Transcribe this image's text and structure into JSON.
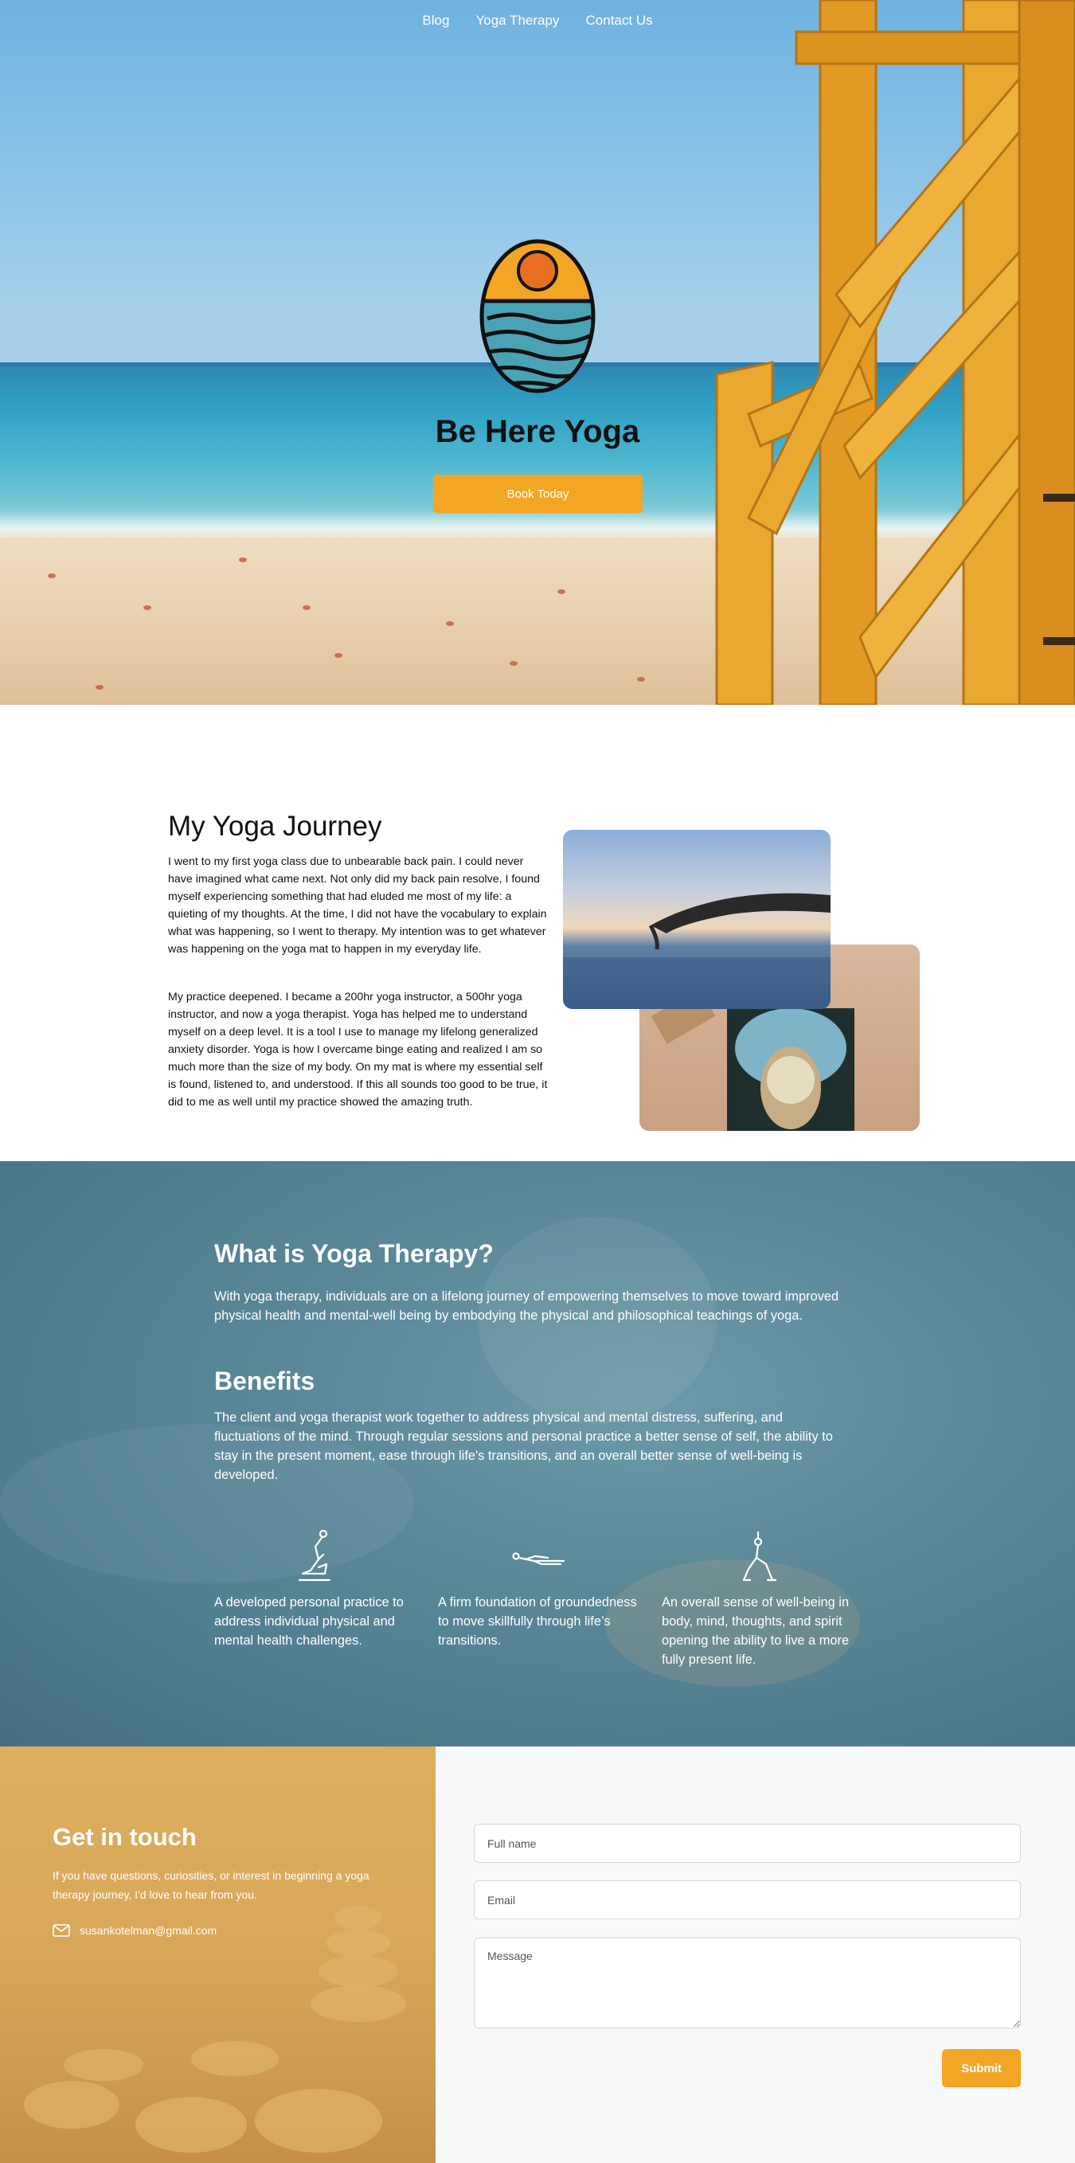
{
  "nav": {
    "items": [
      "Blog",
      "Yoga Therapy",
      "Contact Us"
    ]
  },
  "hero": {
    "title": "Be Here Yoga",
    "cta_label": "Book Today",
    "logo_icon": "sun-over-water-logo-icon"
  },
  "journey": {
    "title": "My Yoga Journey",
    "paragraph1": "I went to my first yoga class due to unbearable back pain. I could never have imagined what came next. Not only did my back pain resolve, I found myself experiencing something that had eluded me most of my life: a quieting of my thoughts. At the time, I did not have the vocabulary to explain what was happening, so I went to therapy. My intention was to get whatever was happening on the yoga mat to happen in my everyday life.",
    "paragraph2": "My practice deepened. I became a 200hr yoga instructor, a 500hr yoga instructor, and now a yoga therapist. Yoga has helped me to understand myself on a deep level. It is a tool I use to manage my lifelong generalized anxiety disorder. Yoga is how I overcame binge eating and realized I am so much more than the size of my body. On my mat is where my essential self is found, listened to, and understood. If this all sounds too good to be true, it did to me as well until my practice showed the amazing truth."
  },
  "therapy": {
    "what_title": "What is Yoga Therapy?",
    "what_text": "With yoga therapy, individuals are on a lifelong journey of empowering themselves to move toward improved physical health and mental-well being by embodying the physical and philosophical teachings of yoga.",
    "benefits_title": "Benefits",
    "benefits_text": "The client and yoga therapist work together to address physical and mental distress, suffering, and fluctuations of the mind. Through regular sessions and personal practice a better sense of self, the ability to stay in the present moment, ease through life's transitions, and an overall better sense of well-being is developed.",
    "benefits": [
      {
        "icon": "seated-yoga-pose-icon",
        "text": "A developed personal practice to address individual physical and mental health challenges."
      },
      {
        "icon": "lying-yoga-pose-icon",
        "text": "A firm foundation of groundedness to move skillfully through life’s transitions."
      },
      {
        "icon": "standing-yoga-pose-icon",
        "text": "An overall sense of well-being in body, mind, thoughts, and spirit opening the ability to live a more fully present life."
      }
    ]
  },
  "contact": {
    "title": "Get in touch",
    "text": "If you have questions, curiosities, or interest in beginning a yoga therapy journey, I'd love to hear from you.",
    "email": "susankotelman@gmail.com",
    "form": {
      "name_placeholder": "Full name",
      "email_placeholder": "Email",
      "message_placeholder": "Message",
      "submit_label": "Submit"
    }
  },
  "colors": {
    "accent": "#f3a623",
    "therapy_bg": "#5a8898",
    "contact_left_bg": "#d9a85a"
  }
}
